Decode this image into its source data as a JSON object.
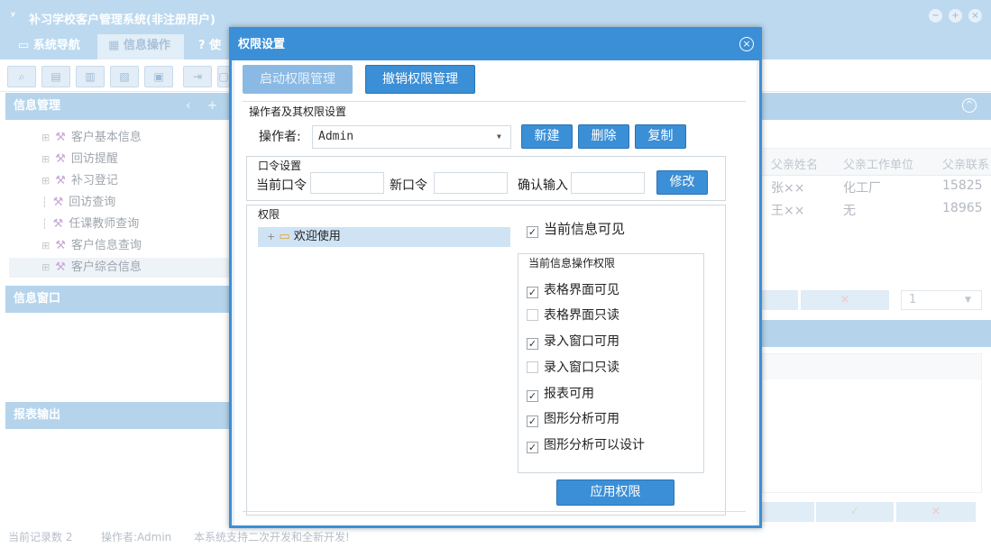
{
  "window": {
    "title": "补习学校客户管理系统(非注册用户)",
    "logo_glyph": "ʸ"
  },
  "tabs": [
    {
      "label": "系统导航",
      "icon": "monitor-icon"
    },
    {
      "label": "信息操作",
      "icon": "grid-icon"
    },
    {
      "label": "使",
      "icon": "help-icon"
    }
  ],
  "sidebar": {
    "info_mgmt_title": "信息管理",
    "items": [
      {
        "label": "客户基本信息"
      },
      {
        "label": "回访提醒"
      },
      {
        "label": "补习登记"
      },
      {
        "label": "回访查询"
      },
      {
        "label": "任课教师查询"
      },
      {
        "label": "客户信息查询"
      },
      {
        "label": "客户综合信息"
      }
    ],
    "info_window_title": "信息窗口",
    "report_title": "报表输出"
  },
  "grid": {
    "headers": [
      "父亲姓名",
      "父亲工作单位",
      "父亲联系"
    ],
    "rows": [
      [
        "张××",
        "化工厂",
        "15825"
      ],
      [
        "王××",
        "无",
        "18965"
      ]
    ],
    "page_value": "1"
  },
  "status": {
    "record_count": "当前记录数 2",
    "operator": "操作者:Admin",
    "note": "本系统支持二次开发和全新开发!"
  },
  "dialog": {
    "title": "权限设置",
    "enable_button": "启动权限管理",
    "revoke_button": "撤销权限管理",
    "operators_legend": "操作者及其权限设置",
    "operator_label": "操作者:",
    "operator_value": "Admin",
    "new_button": "新建",
    "delete_button": "删除",
    "copy_button": "复制",
    "password_legend": "口令设置",
    "current_pw_label": "当前口令",
    "new_pw_label": "新口令",
    "confirm_pw_label": "确认输入",
    "modify_button": "修改",
    "permissions_legend": "权限",
    "tree_root": "欢迎使用",
    "current_visible_label": "当前信息可见",
    "current_visible_checked": true,
    "ops_legend": "当前信息操作权限",
    "ops": [
      {
        "label": "表格界面可见",
        "checked": true
      },
      {
        "label": "表格界面只读",
        "checked": false
      },
      {
        "label": "录入窗口可用",
        "checked": true
      },
      {
        "label": "录入窗口只读",
        "checked": false
      },
      {
        "label": "报表可用",
        "checked": true
      },
      {
        "label": "图形分析可用",
        "checked": true
      },
      {
        "label": "图形分析可以设计",
        "checked": true
      }
    ],
    "apply_button": "应用权限"
  },
  "colors": {
    "accent": "#3b8fd6",
    "panel_header": "#b5d4ec",
    "title_bar": "#bcd9ef"
  }
}
